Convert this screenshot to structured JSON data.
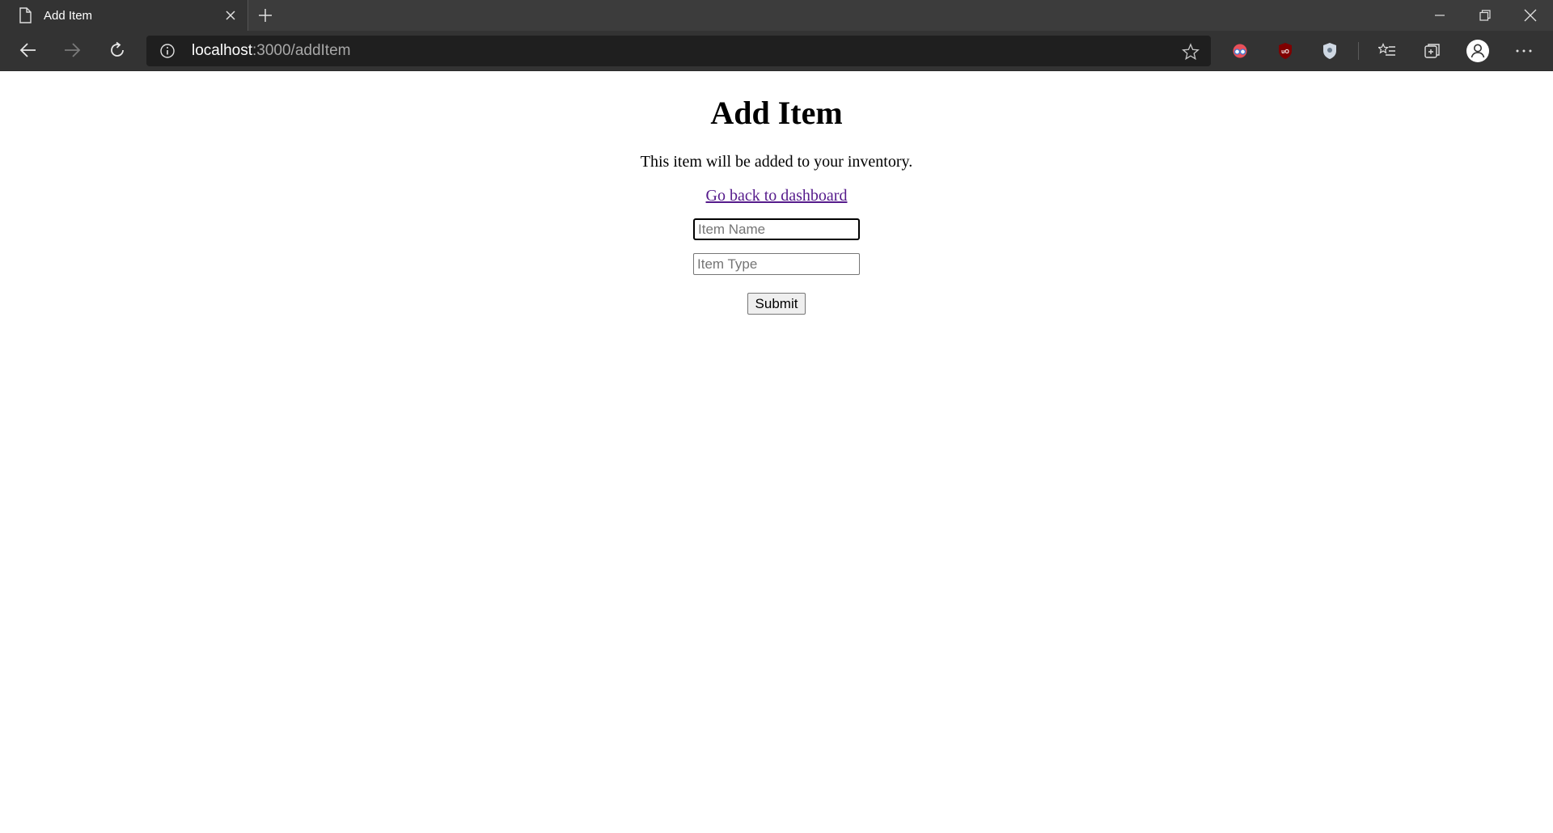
{
  "browser": {
    "tab_title": "Add Item",
    "url_host": "localhost",
    "url_rest": ":3000/addItem"
  },
  "page": {
    "heading": "Add Item",
    "description": "This item will be added to your inventory.",
    "back_link": "Go back to dashboard",
    "item_name_placeholder": "Item Name",
    "item_type_placeholder": "Item Type",
    "submit_label": "Submit"
  }
}
